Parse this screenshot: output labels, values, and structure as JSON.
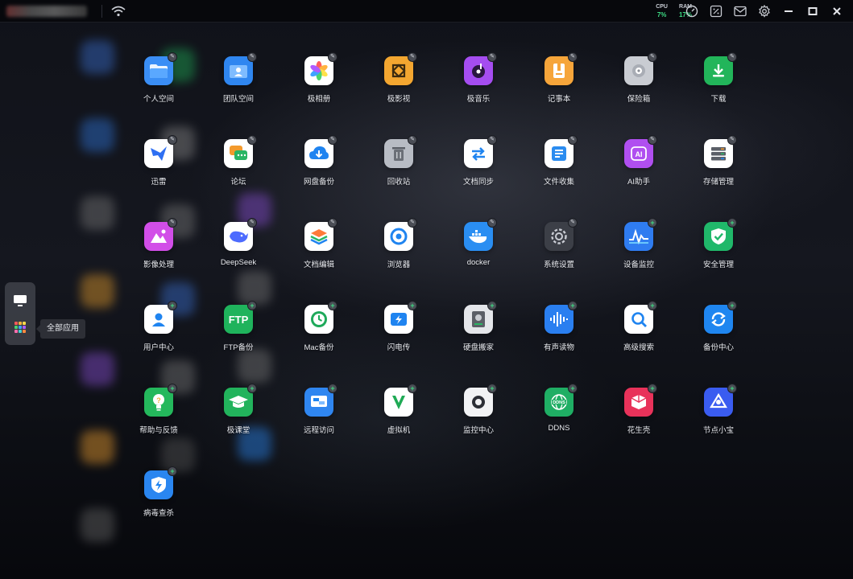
{
  "topbar": {
    "cpu_label": "CPU",
    "cpu_value": "7%",
    "ram_label": "RAM",
    "ram_value": "17%",
    "icons": [
      "wifi-icon",
      "gauge-icon",
      "percent-icon",
      "mail-icon",
      "gear-icon",
      "minimize-icon",
      "maximize-icon",
      "close-icon"
    ]
  },
  "dock": {
    "items": [
      {
        "icon": "desktop-icon"
      },
      {
        "icon": "all-apps-grid-icon"
      }
    ],
    "tooltip": "全部应用"
  },
  "apps": [
    {
      "label": "个人空间",
      "icon": "folder-icon",
      "badge": "pin",
      "color": "#3a8ef5"
    },
    {
      "label": "团队空间",
      "icon": "team-folder-icon",
      "badge": "pin",
      "color": "#2f86f0"
    },
    {
      "label": "极相册",
      "icon": "photos-flower-icon",
      "badge": "pin",
      "color": "#ffffff"
    },
    {
      "label": "极影视",
      "icon": "video-icon",
      "badge": "pin",
      "color": "#f3a630"
    },
    {
      "label": "极音乐",
      "icon": "music-disc-icon",
      "badge": "pin",
      "color": "#a54df0"
    },
    {
      "label": "记事本",
      "icon": "notebook-icon",
      "badge": "pin",
      "color": "#f6a53a"
    },
    {
      "label": "保险箱",
      "icon": "safe-icon",
      "badge": "pin",
      "color": "#c9ccd2"
    },
    {
      "label": "下载",
      "icon": "download-icon",
      "badge": "pin",
      "color": "#22b55a"
    },
    {
      "label": "迅雷",
      "icon": "thunder-bird-icon",
      "badge": "pin",
      "color": "#ffffff"
    },
    {
      "label": "论坛",
      "icon": "chat-bubble-icon",
      "badge": "pin",
      "color": "#ffffff"
    },
    {
      "label": "网盘备份",
      "icon": "cloud-download-icon",
      "badge": "pin",
      "color": "#ffffff"
    },
    {
      "label": "回收站",
      "icon": "trash-icon",
      "badge": "pin",
      "color": "#b8bcc4"
    },
    {
      "label": "文档同步",
      "icon": "sync-arrows-icon",
      "badge": "pin",
      "color": "#ffffff"
    },
    {
      "label": "文件收集",
      "icon": "file-collect-icon",
      "badge": "pin",
      "color": "#ffffff"
    },
    {
      "label": "AI助手",
      "icon": "ai-chip-icon",
      "badge": "pin",
      "color": "#b04ff0"
    },
    {
      "label": "存储管理",
      "icon": "storage-stack-icon",
      "badge": "pin",
      "color": "#ffffff"
    },
    {
      "label": "影像处理",
      "icon": "image-mountain-icon",
      "badge": "pin",
      "color": "#d24ee8"
    },
    {
      "label": "DeepSeek",
      "icon": "whale-icon",
      "badge": "pin",
      "color": "#ffffff"
    },
    {
      "label": "文档编辑",
      "icon": "document-layers-icon",
      "badge": "pin",
      "color": "#ffffff"
    },
    {
      "label": "浏览器",
      "icon": "browser-icon",
      "badge": "pin",
      "color": "#ffffff"
    },
    {
      "label": "docker",
      "icon": "docker-whale-icon",
      "badge": "pin",
      "color": "#2a8ef2"
    },
    {
      "label": "系统设置",
      "icon": "settings-gear-icon",
      "badge": "pin",
      "color": "#3c3f47"
    },
    {
      "label": "设备监控",
      "icon": "pulse-chart-icon",
      "badge": "plus",
      "color": "#2f7cf0"
    },
    {
      "label": "安全管理",
      "icon": "shield-check-icon",
      "badge": "plus",
      "color": "#20b86a"
    },
    {
      "label": "用户中心",
      "icon": "user-icon",
      "badge": "plus",
      "color": "#ffffff"
    },
    {
      "label": "FTP备份",
      "icon": "ftp-icon",
      "badge": "plus",
      "color": "#1fb35c"
    },
    {
      "label": "Mac备份",
      "icon": "time-machine-icon",
      "badge": "plus",
      "color": "#ffffff"
    },
    {
      "label": "闪电传",
      "icon": "lightning-transfer-icon",
      "badge": "plus",
      "color": "#ffffff"
    },
    {
      "label": "硬盘搬家",
      "icon": "hard-drive-icon",
      "badge": "plus",
      "color": "#e4e6ea"
    },
    {
      "label": "有声读物",
      "icon": "audio-wave-icon",
      "badge": "plus",
      "color": "#2a7ff0"
    },
    {
      "label": "高级搜索",
      "icon": "search-icon",
      "badge": "plus",
      "color": "#ffffff"
    },
    {
      "label": "备份中心",
      "icon": "backup-cycle-icon",
      "badge": "plus",
      "color": "#1f86f0"
    },
    {
      "label": "帮助与反馈",
      "icon": "lightbulb-icon",
      "badge": "plus",
      "color": "#24b85c"
    },
    {
      "label": "极课堂",
      "icon": "graduation-cap-icon",
      "badge": "plus",
      "color": "#22b35c"
    },
    {
      "label": "远程访问",
      "icon": "remote-access-icon",
      "badge": "plus",
      "color": "#2f86f0"
    },
    {
      "label": "虚拟机",
      "icon": "virtual-machine-icon",
      "badge": "plus",
      "color": "#ffffff"
    },
    {
      "label": "监控中心",
      "icon": "camera-icon",
      "badge": "plus",
      "color": "#f1f2f4"
    },
    {
      "label": "DDNS",
      "icon": "ddns-globe-icon",
      "badge": "plus",
      "color": "#1fae64"
    },
    {
      "label": "花生壳",
      "icon": "peanut-box-icon",
      "badge": "plus",
      "color": "#e8325a"
    },
    {
      "label": "节点小宝",
      "icon": "node-link-icon",
      "badge": "plus",
      "color": "#3a5cf0"
    },
    {
      "label": "病毒查杀",
      "icon": "antivirus-shield-icon",
      "badge": "plus",
      "color": "#2a86f0"
    }
  ]
}
